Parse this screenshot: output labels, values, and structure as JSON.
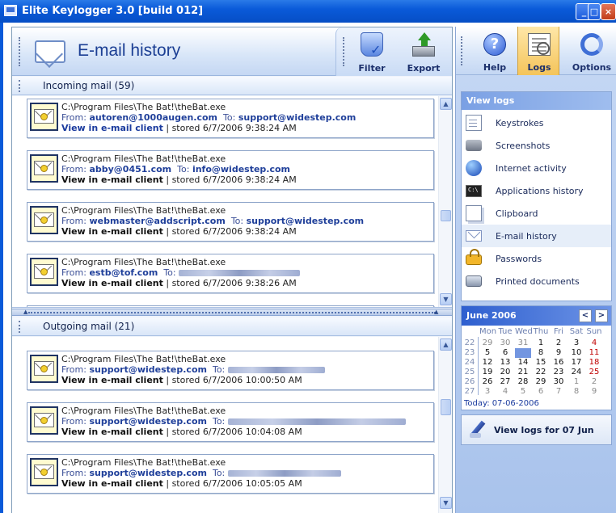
{
  "window": {
    "title": "Elite Keylogger 3.0 [build 012]",
    "accent": "#0a5ad9"
  },
  "left_panel": {
    "title": "E-mail history",
    "toolbar": {
      "filter_label": "Filter",
      "export_label": "Export"
    },
    "incoming": {
      "header": "Incoming mail (59)",
      "items": [
        {
          "path": "C:\\Program Files\\The Bat!\\theBat.exe",
          "from_label": "From:",
          "from": "autoren@1000augen.com",
          "to_label": "To:",
          "to": "support@widestep.com",
          "view_label": "View in e-mail client",
          "stored": "| stored 6/7/2006 9:38:24 AM",
          "link_blue": true
        },
        {
          "path": "C:\\Program Files\\The Bat!\\theBat.exe",
          "from_label": "From:",
          "from": "abby@0451.com",
          "to_label": "To:",
          "to": "info@widestep.com",
          "view_label": "View in e-mail client",
          "stored": "| stored 6/7/2006 9:38:24 AM",
          "link_blue": false
        },
        {
          "path": "C:\\Program Files\\The Bat!\\theBat.exe",
          "from_label": "From:",
          "from": "webmaster@addscript.com",
          "to_label": "To:",
          "to": "support@widestep.com",
          "view_label": "View in e-mail client",
          "stored": "| stored 6/7/2006 9:38:24 AM",
          "link_blue": false
        },
        {
          "path": "C:\\Program Files\\The Bat!\\theBat.exe",
          "from_label": "From:",
          "from": "estb@tof.com",
          "to_label": "To:",
          "to": "",
          "view_label": "View in e-mail client",
          "stored": "| stored 6/7/2006 9:38:26 AM",
          "link_blue": false
        }
      ]
    },
    "outgoing": {
      "header": "Outgoing mail (21)",
      "items": [
        {
          "path": "C:\\Program Files\\The Bat!\\theBat.exe",
          "from_label": "From:",
          "from": "support@widestep.com",
          "to_label": "To:",
          "to": "",
          "view_label": "View in e-mail client",
          "stored": "| stored 6/7/2006 10:00:50 AM"
        },
        {
          "path": "C:\\Program Files\\The Bat!\\theBat.exe",
          "from_label": "From:",
          "from": "support@widestep.com",
          "to_label": "To:",
          "to": "",
          "view_label": "View in e-mail client",
          "stored": "| stored 6/7/2006 10:04:08 AM"
        },
        {
          "path": "C:\\Program Files\\The Bat!\\theBat.exe",
          "from_label": "From:",
          "from": "support@widestep.com",
          "to_label": "To:",
          "to": "",
          "view_label": "View in e-mail client",
          "stored": "| stored 6/7/2006 10:05:05 AM"
        }
      ]
    }
  },
  "right_panel": {
    "toolbar": {
      "help_label": "Help",
      "logs_label": "Logs",
      "options_label": "Options"
    },
    "view_logs": {
      "title": "View logs",
      "items": [
        {
          "label": "Keystrokes",
          "icon": "document-icon"
        },
        {
          "label": "Screenshots",
          "icon": "camera-icon"
        },
        {
          "label": "Internet activity",
          "icon": "globe-icon"
        },
        {
          "label": "Applications history",
          "icon": "terminal-icon"
        },
        {
          "label": "Clipboard",
          "icon": "clipboard-icon"
        },
        {
          "label": "E-mail history",
          "icon": "envelope-icon",
          "active": true
        },
        {
          "label": "Passwords",
          "icon": "lock-icon"
        },
        {
          "label": "Printed documents",
          "icon": "printer-icon"
        }
      ]
    },
    "calendar": {
      "title": "June 2006",
      "prev_label": "<",
      "next_label": ">",
      "weekdays": [
        "Mon",
        "Tue",
        "Wed",
        "Thu",
        "Fri",
        "Sat",
        "Sun"
      ],
      "weeks": [
        {
          "num": "22",
          "days": [
            "29",
            "30",
            "31",
            "1",
            "2",
            "3",
            "4"
          ]
        },
        {
          "num": "23",
          "days": [
            "5",
            "6",
            "7",
            "8",
            "9",
            "10",
            "11"
          ]
        },
        {
          "num": "24",
          "days": [
            "12",
            "13",
            "14",
            "15",
            "16",
            "17",
            "18"
          ]
        },
        {
          "num": "25",
          "days": [
            "19",
            "20",
            "21",
            "22",
            "23",
            "24",
            "25"
          ]
        },
        {
          "num": "26",
          "days": [
            "26",
            "27",
            "28",
            "29",
            "30",
            "1",
            "2"
          ]
        },
        {
          "num": "27",
          "days": [
            "3",
            "4",
            "5",
            "6",
            "7",
            "8",
            "9"
          ]
        }
      ],
      "selected_day": "7",
      "today_label": "Today: 07-06-2006"
    },
    "view_for_label": "View logs for 07 Jun"
  }
}
